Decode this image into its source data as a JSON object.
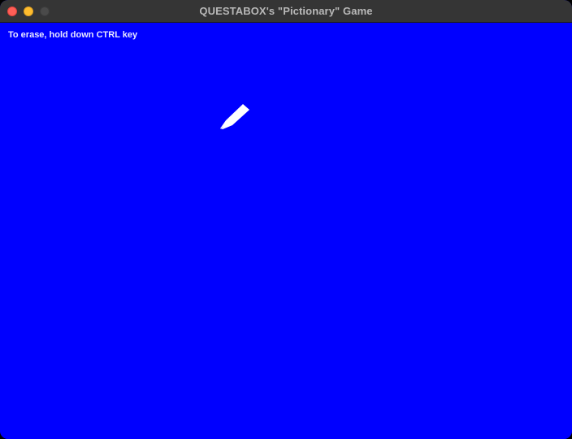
{
  "window": {
    "title": "QUESTABOX's \"Pictionary\" Game",
    "traffic_lights": [
      "close",
      "minimize",
      "zoom"
    ]
  },
  "canvas": {
    "background_color": "#0000ff",
    "hint_text": "To erase, hold down CTRL key",
    "cursor_icon": "pencil-icon"
  }
}
